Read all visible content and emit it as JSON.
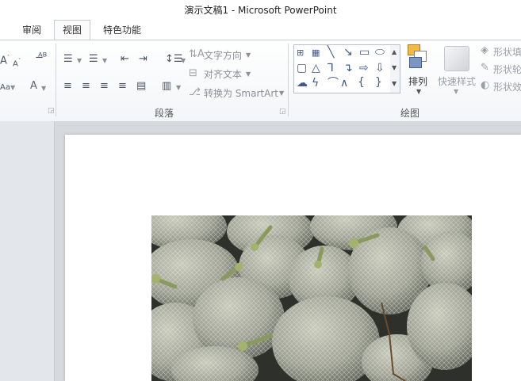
{
  "window": {
    "title": "演示文稿1  -  Microsoft PowerPoint"
  },
  "tabs": [
    {
      "label": "审阅",
      "active": false
    },
    {
      "label": "视图",
      "active": true
    },
    {
      "label": "特色功能",
      "active": false
    }
  ],
  "ribbon": {
    "paragraph": {
      "text_direction_label": "文字方向",
      "align_text_label": "对齐文本",
      "smartart_label": "转换为 SmartArt",
      "group_label": "段落"
    },
    "drawing": {
      "arrange_label": "排列",
      "quick_styles_label": "快速样式",
      "shape_fill_label": "形状填",
      "shape_outline_label": "形状轮",
      "shape_effects_label": "形状效",
      "group_label": "绘图"
    }
  },
  "slide": {
    "image_icon": "melon-photo"
  },
  "colors": {
    "ribbon_bg": "#f3f5f8",
    "workspace_bg": "#d6d9de",
    "shape_outline": "#3f5a8a"
  }
}
